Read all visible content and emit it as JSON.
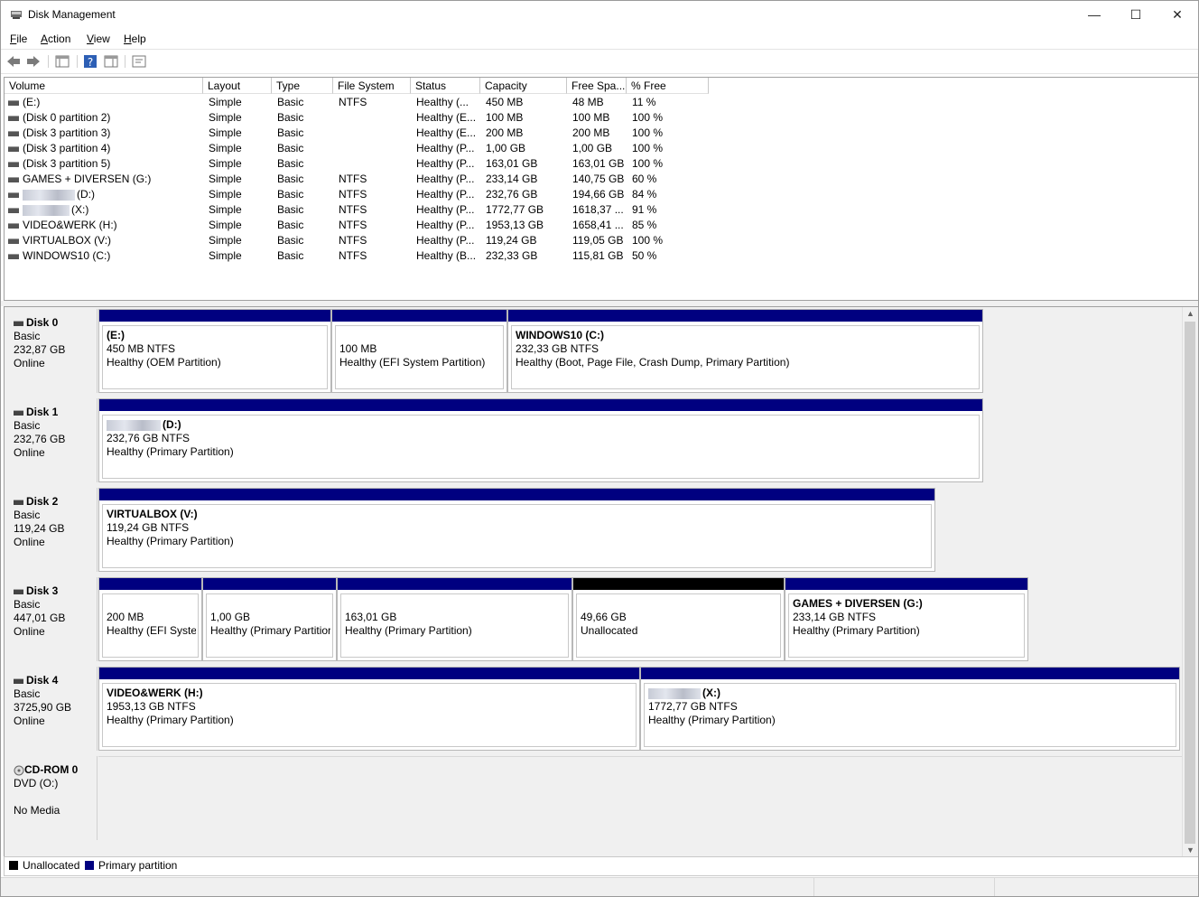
{
  "window": {
    "title": "Disk Management",
    "minimize": "—",
    "maximize": "☐",
    "close": "✕"
  },
  "menu": [
    {
      "u": "F",
      "rest": "ile"
    },
    {
      "u": "A",
      "rest": "ction"
    },
    {
      "u": "V",
      "rest": "iew"
    },
    {
      "u": "H",
      "rest": "elp"
    }
  ],
  "columns": [
    "Volume",
    "Layout",
    "Type",
    "File System",
    "Status",
    "Capacity",
    "Free Spa...",
    "% Free"
  ],
  "volumes": [
    {
      "name": "(E:)",
      "layout": "Simple",
      "type": "Basic",
      "fs": "NTFS",
      "status": "Healthy (...",
      "capacity": "450 MB",
      "free": "48 MB",
      "pct": "11 %"
    },
    {
      "name": "(Disk 0 partition 2)",
      "layout": "Simple",
      "type": "Basic",
      "fs": "",
      "status": "Healthy (E...",
      "capacity": "100 MB",
      "free": "100 MB",
      "pct": "100 %"
    },
    {
      "name": "(Disk 3 partition 3)",
      "layout": "Simple",
      "type": "Basic",
      "fs": "",
      "status": "Healthy (E...",
      "capacity": "200 MB",
      "free": "200 MB",
      "pct": "100 %"
    },
    {
      "name": "(Disk 3 partition 4)",
      "layout": "Simple",
      "type": "Basic",
      "fs": "",
      "status": "Healthy (P...",
      "capacity": "1,00 GB",
      "free": "1,00 GB",
      "pct": "100 %"
    },
    {
      "name": "(Disk 3 partition 5)",
      "layout": "Simple",
      "type": "Basic",
      "fs": "",
      "status": "Healthy (P...",
      "capacity": "163,01 GB",
      "free": "163,01 GB",
      "pct": "100 %"
    },
    {
      "name": "GAMES + DIVERSEN (G:)",
      "layout": "Simple",
      "type": "Basic",
      "fs": "NTFS",
      "status": "Healthy (P...",
      "capacity": "233,14 GB",
      "free": "140,75 GB",
      "pct": "60 %"
    },
    {
      "name": "(D:)",
      "layout": "Simple",
      "type": "Basic",
      "fs": "NTFS",
      "status": "Healthy (P...",
      "capacity": "232,76 GB",
      "free": "194,66 GB",
      "pct": "84 %"
    },
    {
      "name": "(X:)",
      "layout": "Simple",
      "type": "Basic",
      "fs": "NTFS",
      "status": "Healthy (P...",
      "capacity": "1772,77 GB",
      "free": "1618,37 ...",
      "pct": "91 %"
    },
    {
      "name": "VIDEO&WERK (H:)",
      "layout": "Simple",
      "type": "Basic",
      "fs": "NTFS",
      "status": "Healthy (P...",
      "capacity": "1953,13 GB",
      "free": "1658,41 ...",
      "pct": "85 %"
    },
    {
      "name": "VIRTUALBOX (V:)",
      "layout": "Simple",
      "type": "Basic",
      "fs": "NTFS",
      "status": "Healthy (P...",
      "capacity": "119,24 GB",
      "free": "119,05 GB",
      "pct": "100 %"
    },
    {
      "name": "WINDOWS10 (C:)",
      "layout": "Simple",
      "type": "Basic",
      "fs": "NTFS",
      "status": "Healthy (B...",
      "capacity": "232,33 GB",
      "free": "115,81 GB",
      "pct": "50 %"
    }
  ],
  "disks": [
    {
      "name": "Disk 0",
      "type": "Basic",
      "size": "232,87 GB",
      "state": "Online",
      "parts": [
        {
          "title": "(E:)",
          "size": "450 MB NTFS",
          "status": "Healthy (OEM Partition)"
        },
        {
          "title": "",
          "size": "100 MB",
          "status": "Healthy (EFI System Partition)"
        },
        {
          "title": "WINDOWS10  (C:)",
          "size": "232,33 GB NTFS",
          "status": "Healthy (Boot, Page File, Crash Dump, Primary Partition)"
        }
      ]
    },
    {
      "name": "Disk 1",
      "type": "Basic",
      "size": "232,76 GB",
      "state": "Online",
      "parts": [
        {
          "title": "(D:)",
          "size": "232,76 GB NTFS",
          "status": "Healthy (Primary Partition)"
        }
      ]
    },
    {
      "name": "Disk 2",
      "type": "Basic",
      "size": "119,24 GB",
      "state": "Online",
      "parts": [
        {
          "title": "VIRTUALBOX  (V:)",
          "size": "119,24 GB NTFS",
          "status": "Healthy (Primary Partition)"
        }
      ]
    },
    {
      "name": "Disk 3",
      "type": "Basic",
      "size": "447,01 GB",
      "state": "Online",
      "parts": [
        {
          "title": "",
          "size": "200 MB",
          "status": "Healthy (EFI Systen"
        },
        {
          "title": "",
          "size": "1,00 GB",
          "status": "Healthy (Primary Partitior"
        },
        {
          "title": "",
          "size": "163,01 GB",
          "status": "Healthy (Primary Partition)"
        },
        {
          "title": "",
          "size": "49,66 GB",
          "status": "Unallocated"
        },
        {
          "title": "GAMES + DIVERSEN  (G:)",
          "size": "233,14 GB NTFS",
          "status": "Healthy (Primary Partition)"
        }
      ]
    },
    {
      "name": "Disk 4",
      "type": "Basic",
      "size": "3725,90 GB",
      "state": "Online",
      "parts": [
        {
          "title": "VIDEO&WERK  (H:)",
          "size": "1953,13 GB NTFS",
          "status": "Healthy (Primary Partition)"
        },
        {
          "title": "(X:)",
          "size": "1772,77 GB NTFS",
          "status": "Healthy (Primary Partition)"
        }
      ]
    }
  ],
  "cdrom": {
    "name": "CD-ROM 0",
    "type": "DVD (O:)",
    "media": "No Media"
  },
  "legend": [
    {
      "label": "Unallocated",
      "color": "#000000"
    },
    {
      "label": "Primary partition",
      "color": "#000080"
    }
  ],
  "colors": {
    "primary": "#000080",
    "unallocated": "#000000"
  }
}
